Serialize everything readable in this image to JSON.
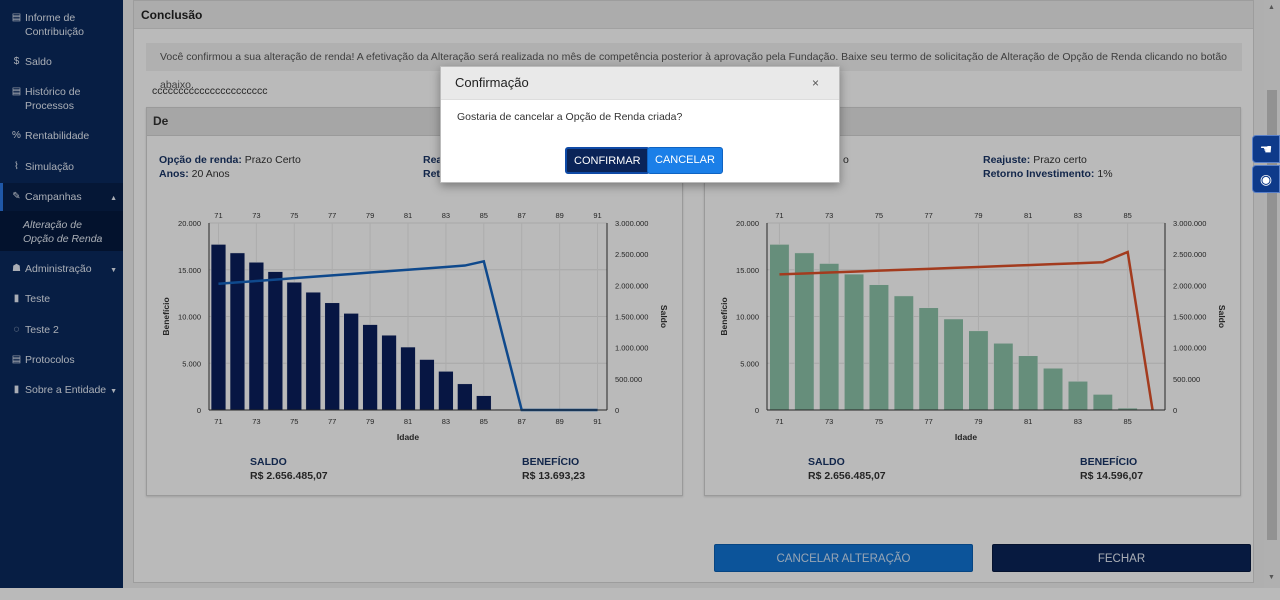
{
  "sidebar": {
    "items": [
      {
        "label": "Informe de Contribuição",
        "icon": "document-icon",
        "glyph": "▤"
      },
      {
        "label": "Saldo",
        "icon": "dollar-icon",
        "glyph": "$"
      },
      {
        "label": "Histórico de Processos",
        "icon": "document-icon",
        "glyph": "▤"
      },
      {
        "label": "Rentabilidade",
        "icon": "percent-icon",
        "glyph": "%"
      },
      {
        "label": "Simulação",
        "icon": "chart-icon",
        "glyph": "⌇"
      },
      {
        "label": "Campanhas",
        "icon": "edit-icon",
        "glyph": "✎",
        "caret": "▲"
      },
      {
        "label": "Administração",
        "icon": "users-icon",
        "glyph": "☗",
        "caret": "▼"
      },
      {
        "label": "Teste",
        "icon": "bookmark-icon",
        "glyph": "▮"
      },
      {
        "label": "Teste 2",
        "icon": "comment-icon",
        "glyph": "◌"
      },
      {
        "label": "Protocolos",
        "icon": "list-icon",
        "glyph": "▤"
      },
      {
        "label": "Sobre a Entidade",
        "icon": "bookmark-icon",
        "glyph": "▮",
        "caret": "▼"
      }
    ],
    "subitem": "Alteração de Opção de Renda"
  },
  "panel": {
    "title": "Conclusão",
    "alert": "Você confirmou a sua alteração de renda! A efetivação da Alteração será realizada no mês de competência posterior à aprovação pela Fundação. Baixe seu termo de solicitação de Alteração de Opção de Renda clicando no botão abaixo.",
    "plain_text": "cccccccccccccccccccccc"
  },
  "card_left": {
    "title": "De",
    "opcao_label": "Opção de renda:",
    "opcao_value": "Prazo Certo",
    "anos_label": "Anos:",
    "anos_value": "20 Anos",
    "reajuste_label_partial": "Rea",
    "retorno_label_partial": "Ret",
    "saldo_label": "SALDO",
    "saldo_value": "R$ 2.656.485,07",
    "beneficio_label": "BENEFÍCIO",
    "beneficio_value": "R$ 13.693,23"
  },
  "card_right": {
    "opcao_value_partial": "o",
    "reajuste_label": "Reajuste:",
    "reajuste_value": "Prazo certo",
    "retorno_label": "Retorno Investimento:",
    "retorno_value": "1%",
    "saldo_label": "SALDO",
    "saldo_value": "R$ 2.656.485,07",
    "beneficio_label": "BENEFÍCIO",
    "beneficio_value": "R$ 14.596,07"
  },
  "chart_data": [
    {
      "type": "bar",
      "xlabel": "Idade",
      "ylabel": "Benefício",
      "y2label": "Saldo",
      "x": [
        71,
        72,
        73,
        74,
        75,
        76,
        77,
        78,
        79,
        80,
        81,
        82,
        83,
        84,
        85,
        86,
        87,
        88,
        89,
        90,
        91
      ],
      "x_ticks": [
        "71",
        "73",
        "75",
        "77",
        "79",
        "81",
        "83",
        "85",
        "87",
        "89",
        "91"
      ],
      "y_ticks": [
        "0",
        "5.000",
        "10.000",
        "15.000",
        "20.000"
      ],
      "y2_ticks": [
        "0",
        "500.000",
        "1.000.000",
        "1.500.000",
        "2.000.000",
        "2.500.000",
        "3.000.000"
      ],
      "ylim": [
        0,
        20000
      ],
      "y2lim": [
        0,
        3000000
      ],
      "bar_values": [
        2656485,
        2520000,
        2370000,
        2220000,
        2050000,
        1890000,
        1720000,
        1550000,
        1370000,
        1200000,
        1010000,
        810000,
        620000,
        420000,
        230000,
        10000,
        0,
        0,
        0,
        0,
        0
      ],
      "line_values": [
        13500,
        13650,
        13800,
        13950,
        14100,
        14250,
        14400,
        14550,
        14700,
        14850,
        15000,
        15150,
        15300,
        15450,
        15900,
        7900,
        0,
        0,
        0,
        0,
        0
      ],
      "bar_color": "#0a1f5c",
      "line_color": "#1565c0"
    },
    {
      "type": "bar",
      "xlabel": "Idade",
      "ylabel": "Benefício",
      "y2label": "Saldo",
      "x": [
        71,
        72,
        73,
        74,
        75,
        76,
        77,
        78,
        79,
        80,
        81,
        82,
        83,
        84,
        85,
        86
      ],
      "x_ticks": [
        "71",
        "73",
        "75",
        "77",
        "79",
        "81",
        "83",
        "85"
      ],
      "y_ticks": [
        "0",
        "5.000",
        "10.000",
        "15.000",
        "20.000"
      ],
      "y2_ticks": [
        "0",
        "500.000",
        "1.000.000",
        "1.500.000",
        "2.000.000",
        "2.500.000",
        "3.000.000"
      ],
      "ylim": [
        0,
        20000
      ],
      "y2lim": [
        0,
        3000000
      ],
      "bar_values": [
        2656485,
        2520000,
        2350000,
        2180000,
        2010000,
        1830000,
        1640000,
        1460000,
        1270000,
        1070000,
        870000,
        670000,
        460000,
        250000,
        30000,
        0
      ],
      "line_values": [
        14500,
        14600,
        14700,
        14800,
        14900,
        15000,
        15100,
        15200,
        15300,
        15400,
        15500,
        15600,
        15700,
        15800,
        16900,
        0
      ],
      "bar_color": "#8dc3a9",
      "line_color": "#e0522a"
    }
  ],
  "buttons": {
    "cancel_alteration": "CANCELAR ALTERAÇÃO",
    "close": "FECHAR"
  },
  "modal": {
    "title": "Confirmação",
    "close_glyph": "×",
    "message": "Gostaria de cancelar a Opção de Renda criada?",
    "confirm": "CONFIRMAR",
    "cancel": "CANCELAR"
  },
  "tools": {
    "sign_language_icon": "☚",
    "eye_icon": "◉"
  }
}
